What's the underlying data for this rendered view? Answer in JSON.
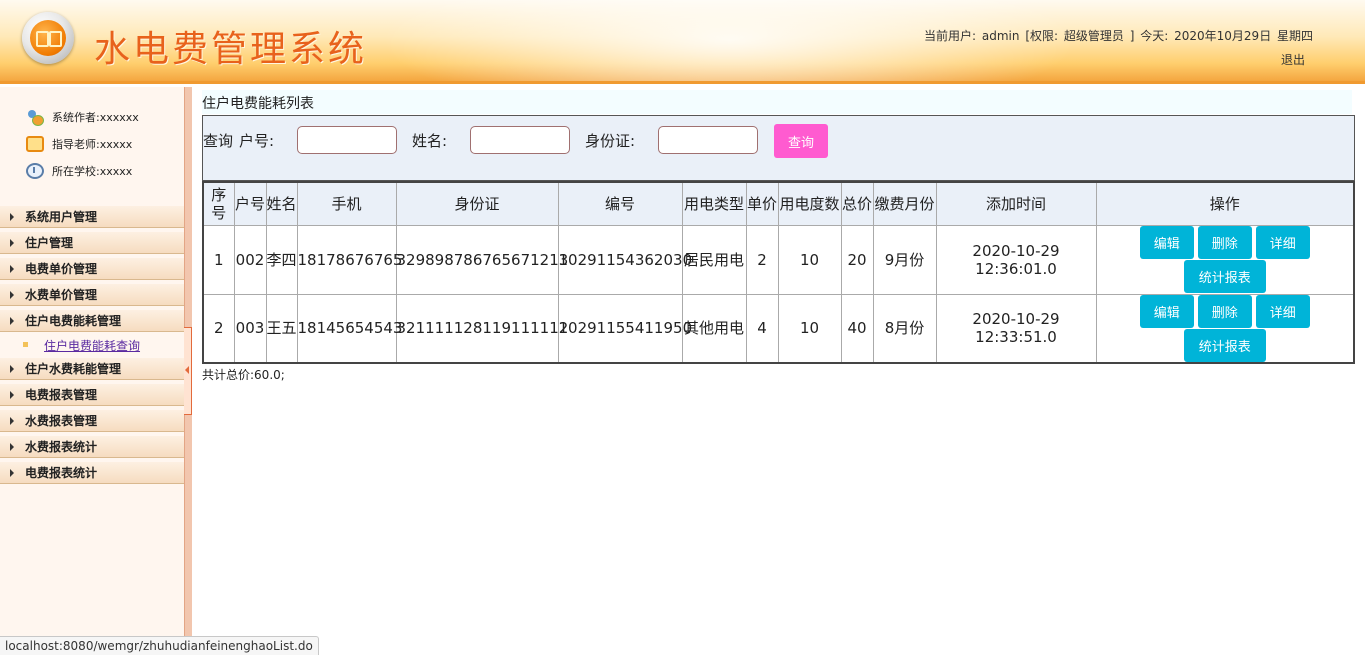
{
  "header": {
    "title": "水电费管理系统",
    "current_user_label": "当前用户:",
    "username": "admin",
    "role_prefix": "[权限:",
    "role": "超级管理员",
    "role_suffix": "]",
    "today_label": "今天:",
    "date": "2020年10月29日",
    "weekday": "星期四",
    "logout": "退出"
  },
  "sidebar": {
    "info": [
      {
        "label": "系统作者:",
        "value": "xxxxxx",
        "icon": "author-icon"
      },
      {
        "label": "指导老师:",
        "value": "xxxxx",
        "icon": "teacher-icon"
      },
      {
        "label": "所在学校:",
        "value": "xxxxx",
        "icon": "school-icon"
      }
    ],
    "menu": [
      {
        "label": "系统用户管理"
      },
      {
        "label": "住户管理"
      },
      {
        "label": "电费单价管理"
      },
      {
        "label": "水费单价管理"
      },
      {
        "label": "住户电费能耗管理",
        "sub": "住户电费能耗查询"
      },
      {
        "label": "住户水费耗能管理"
      },
      {
        "label": "电费报表管理"
      },
      {
        "label": "水费报表管理"
      },
      {
        "label": "水费报表统计"
      },
      {
        "label": "电费报表统计"
      }
    ]
  },
  "main": {
    "page_title": "住户电费能耗列表",
    "search": {
      "query_label": "查询",
      "household_label": "户号:",
      "name_label": "姓名:",
      "id_label": "身份证:",
      "household_value": "",
      "name_value": "",
      "id_value": "",
      "button": "查询"
    },
    "table": {
      "headers": [
        "序号",
        "户号",
        "姓名",
        "手机",
        "身份证",
        "编号",
        "用电类型",
        "单价",
        "用电度数",
        "总价",
        "缴费月份",
        "添加时间",
        "操作"
      ],
      "rows": [
        [
          "1",
          "002",
          "李四",
          "18178676765",
          "329898786765671213",
          "10291154362030",
          "居民用电",
          "2",
          "10",
          "20",
          "9月份",
          "2020-10-29 12:36:01.0"
        ],
        [
          "2",
          "003",
          "王五",
          "18145654543",
          "321111128119111112",
          "10291155411950",
          "其他用电",
          "4",
          "10",
          "40",
          "8月份",
          "2020-10-29 12:33:51.0"
        ]
      ],
      "actions": {
        "edit": "编辑",
        "delete": "删除",
        "detail": "详细",
        "report": "统计报表"
      }
    },
    "total": "共计总价:60.0;"
  },
  "status_bar": "localhost:8080/wemgr/zhuhudianfeinenghaoList.do",
  "colors": {
    "title": "#e8621c",
    "search_button": "#ff5bd0",
    "action_button": "#00b4d8",
    "sub_link": "#5a2aa0"
  }
}
